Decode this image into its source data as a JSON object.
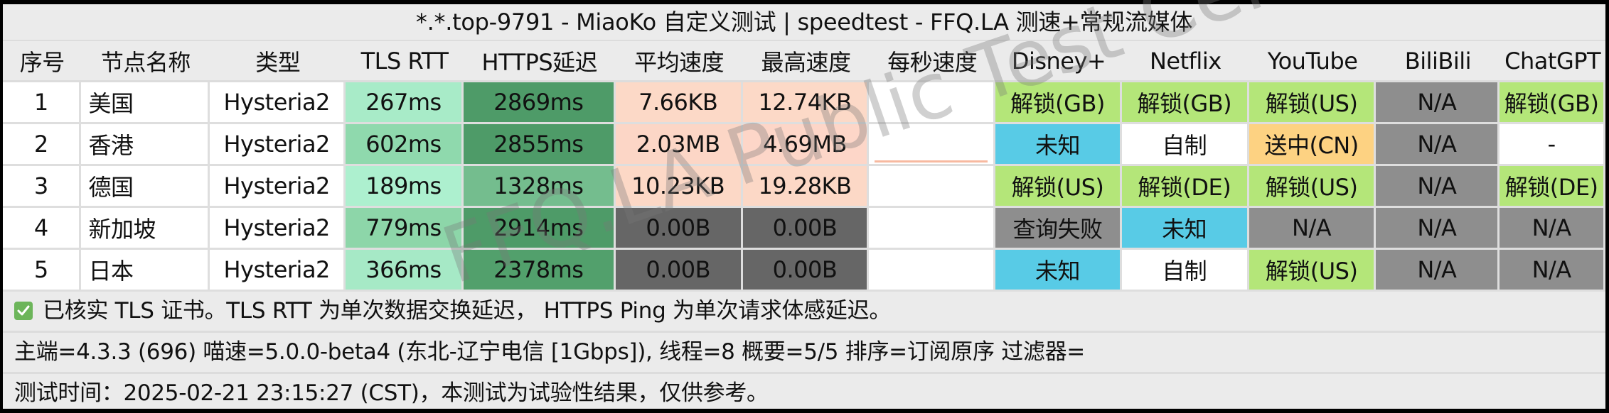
{
  "title": "*.*.top-9791 - MiaoKo 自定义测试 | speedtest - FFQ.LA 测速+常规流媒体",
  "columns": [
    "序号",
    "节点名称",
    "类型",
    "TLS RTT",
    "HTTPS延迟",
    "平均速度",
    "最高速度",
    "每秒速度",
    "Disney+",
    "Netflix",
    "YouTube",
    "BiliBili",
    "ChatGPT"
  ],
  "rows": [
    {
      "index": "1",
      "name": "美国",
      "type": "Hysteria2",
      "tls_rtt": "267ms",
      "https_delay": "2869ms",
      "avg_speed": "7.66KB",
      "max_speed": "12.74KB",
      "per_sec": "",
      "disney": "解锁(GB)",
      "netflix": "解锁(GB)",
      "youtube": "解锁(US)",
      "bilibili": "N/A",
      "chatgpt": "解锁(GB)"
    },
    {
      "index": "2",
      "name": "香港",
      "type": "Hysteria2",
      "tls_rtt": "602ms",
      "https_delay": "2855ms",
      "avg_speed": "2.03MB",
      "max_speed": "4.69MB",
      "per_sec": "",
      "disney": "未知",
      "netflix": "自制",
      "youtube": "送中(CN)",
      "bilibili": "N/A",
      "chatgpt": "-"
    },
    {
      "index": "3",
      "name": "德国",
      "type": "Hysteria2",
      "tls_rtt": "189ms",
      "https_delay": "1328ms",
      "avg_speed": "10.23KB",
      "max_speed": "19.28KB",
      "per_sec": "",
      "disney": "解锁(US)",
      "netflix": "解锁(DE)",
      "youtube": "解锁(US)",
      "bilibili": "N/A",
      "chatgpt": "解锁(DE)"
    },
    {
      "index": "4",
      "name": "新加坡",
      "type": "Hysteria2",
      "tls_rtt": "779ms",
      "https_delay": "2914ms",
      "avg_speed": "0.00B",
      "max_speed": "0.00B",
      "per_sec": "",
      "disney": "查询失败",
      "netflix": "未知",
      "youtube": "N/A",
      "bilibili": "N/A",
      "chatgpt": "N/A"
    },
    {
      "index": "5",
      "name": "日本",
      "type": "Hysteria2",
      "tls_rtt": "366ms",
      "https_delay": "2378ms",
      "avg_speed": "0.00B",
      "max_speed": "0.00B",
      "per_sec": "",
      "disney": "未知",
      "netflix": "自制",
      "youtube": "解锁(US)",
      "bilibili": "N/A",
      "chatgpt": "N/A"
    }
  ],
  "cell_colors": {
    "tls_rtt": [
      "#a8ebc8",
      "#8fd9ad",
      "#adf0cf",
      "#8dd6a9",
      "#a6e9c6"
    ],
    "https_delay": [
      "#4e9b68",
      "#4e9b68",
      "#74bd8e",
      "#4e9b68",
      "#52a06c"
    ],
    "avg_speed": [
      "#fcd9c7",
      "#fcd6c6",
      "#fcd8c6",
      "#666666",
      "#666666"
    ],
    "max_speed": [
      "#fcd9c7",
      "#fdd6c8",
      "#fcd8c6",
      "#666666",
      "#666666"
    ],
    "status": {
      "解锁": "#b4e679",
      "未知": "#58cbe6",
      "自制": "#ffffff",
      "送中": "#fdd282",
      "N/A": "#8e8e8e",
      "查询失败": "#8e8e8e",
      "-": "#ffffff"
    },
    "sparkline": "#f7b9a0"
  },
  "per_sec_sparkline_row": 1,
  "footer": {
    "tls_note": "已核实 TLS 证书。TLS RTT 为单次数据交换延迟， HTTPS Ping 为单次请求体感延迟。",
    "info": "主端=4.3.3 (696) 喵速=5.0.0-beta4 (东北-辽宁电信 [1Gbps]), 线程=8 概要=5/5 排序=订阅原序 过滤器=",
    "test_time": "测试时间：2025-02-21 23:15:27 (CST)，本测试为试验性结果，仅供参考。"
  },
  "watermark": "FFQ.LA Public Test Center"
}
